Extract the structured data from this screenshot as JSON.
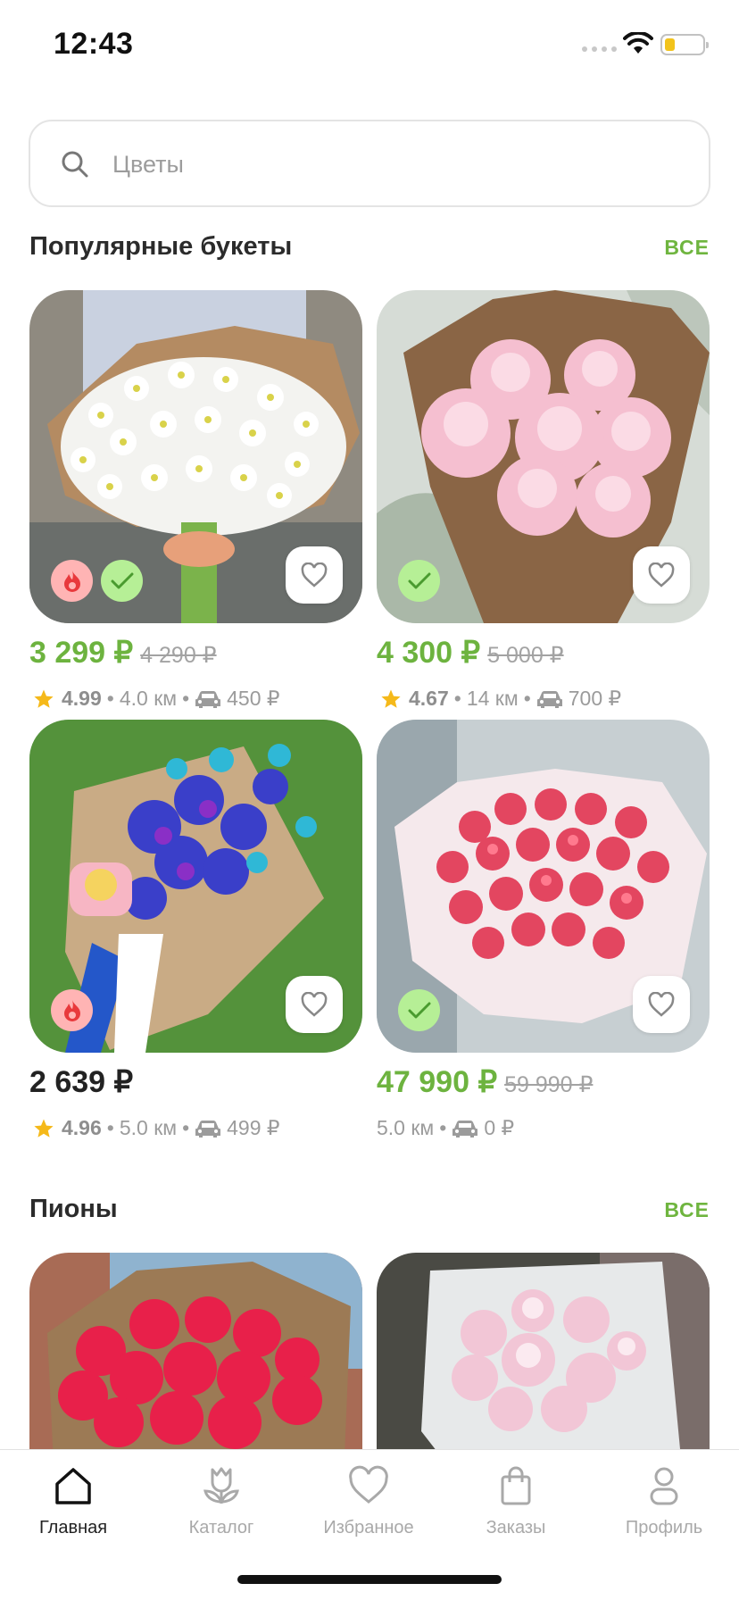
{
  "status_bar": {
    "time": "12:43",
    "battery_level": 0.2
  },
  "search": {
    "placeholder": "Цветы",
    "value": ""
  },
  "sections": [
    {
      "title": "Популярные букеты",
      "all_label": "ВСЕ",
      "products": [
        {
          "price": "3 299 ₽",
          "old_price": "4 290 ₽",
          "rating": "4.99",
          "distance": "4.0 км",
          "delivery": "450 ₽",
          "badges": [
            "hot",
            "check"
          ],
          "price_color": "#6db33f"
        },
        {
          "price": "4 300 ₽",
          "old_price": "5 000 ₽",
          "rating": "4.67",
          "distance": "14 км",
          "delivery": "700 ₽",
          "badges": [
            "check"
          ],
          "price_color": "#6db33f"
        },
        {
          "price": "2 639 ₽",
          "old_price": "",
          "rating": "4.96",
          "distance": "5.0 км",
          "delivery": "499 ₽",
          "badges": [
            "hot"
          ],
          "price_color": "#222222"
        },
        {
          "price": "47 990 ₽",
          "old_price": "59 990 ₽",
          "rating": "",
          "distance": "5.0 км",
          "delivery": "0 ₽",
          "badges": [
            "check"
          ],
          "price_color": "#6db33f"
        }
      ]
    },
    {
      "title": "Пионы",
      "all_label": "ВСЕ",
      "products": []
    }
  ],
  "tab_bar": {
    "items": [
      {
        "label": "Главная",
        "icon": "home-icon",
        "active": true
      },
      {
        "label": "Каталог",
        "icon": "tulip-icon",
        "active": false
      },
      {
        "label": "Избранное",
        "icon": "heart-icon",
        "active": false
      },
      {
        "label": "Заказы",
        "icon": "bag-icon",
        "active": false
      },
      {
        "label": "Профиль",
        "icon": "profile-icon",
        "active": false
      }
    ]
  },
  "colors": {
    "accent": "#6fb53f",
    "badge_hot": "#ffb4b4",
    "badge_check": "#b6ef96",
    "text_muted": "#9b9b9b"
  }
}
